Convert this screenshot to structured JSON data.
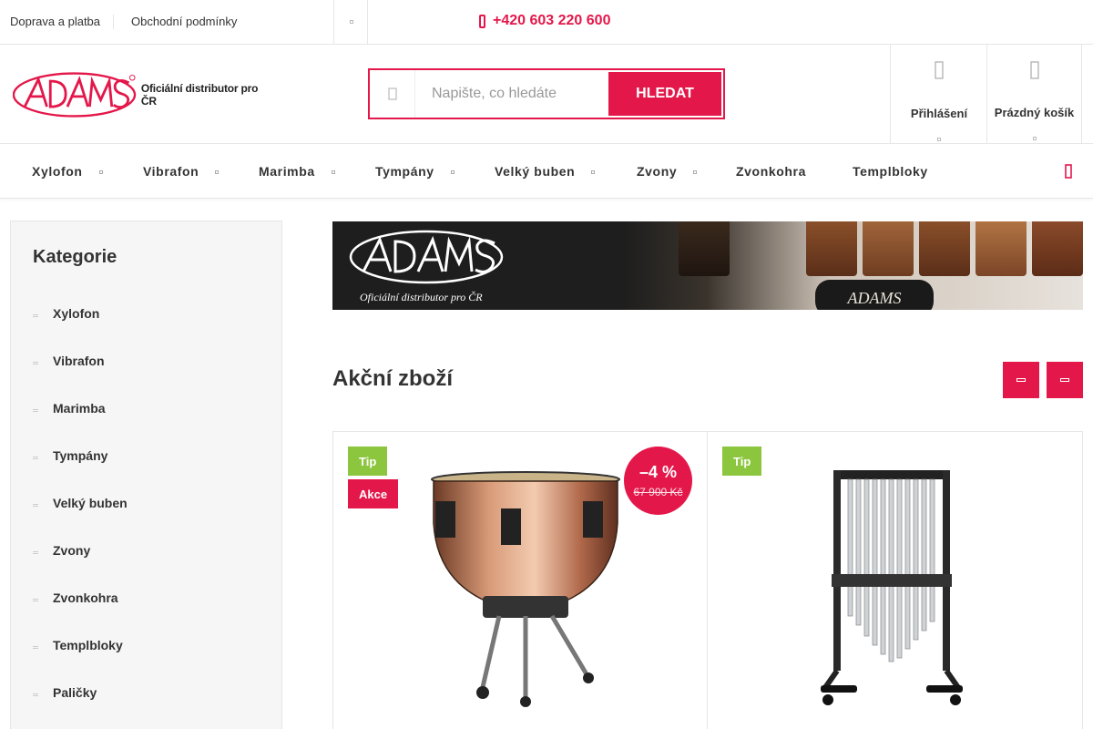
{
  "topbar": {
    "links": [
      "Doprava a platba",
      "Obchodní podmínky"
    ],
    "phone": "+420 603 220 600"
  },
  "header": {
    "logo_tagline": "Oficiální distributor pro ČR",
    "search": {
      "placeholder": "Napište, co hledáte",
      "button": "HLEDAT"
    },
    "login_label": "Přihlášení",
    "cart_label": "Prázdný košík"
  },
  "nav": {
    "items": [
      "Xylofon",
      "Vibrafon",
      "Marimba",
      "Tympány",
      "Velký buben",
      "Zvony",
      "Zvonkohra",
      "Templbloky"
    ]
  },
  "sidebar": {
    "title": "Kategorie",
    "items": [
      "Xylofon",
      "Vibrafon",
      "Marimba",
      "Tympány",
      "Velký buben",
      "Zvony",
      "Zvonkohra",
      "Templbloky",
      "Paličky"
    ]
  },
  "banner": {
    "tagline": "Oficiální distributor pro ČR"
  },
  "section": {
    "title": "Akční zboží"
  },
  "products": [
    {
      "badges": [
        "Tip",
        "Akce"
      ],
      "discount": "–4 %",
      "old_price": "67 900 Kč",
      "image": "timpani-drum"
    },
    {
      "badges": [
        "Tip"
      ],
      "image": "tubular-bells"
    }
  ],
  "colors": {
    "accent": "#e4174a",
    "tip": "#8cc63f",
    "sidebar_bg": "#f6f6f6"
  }
}
